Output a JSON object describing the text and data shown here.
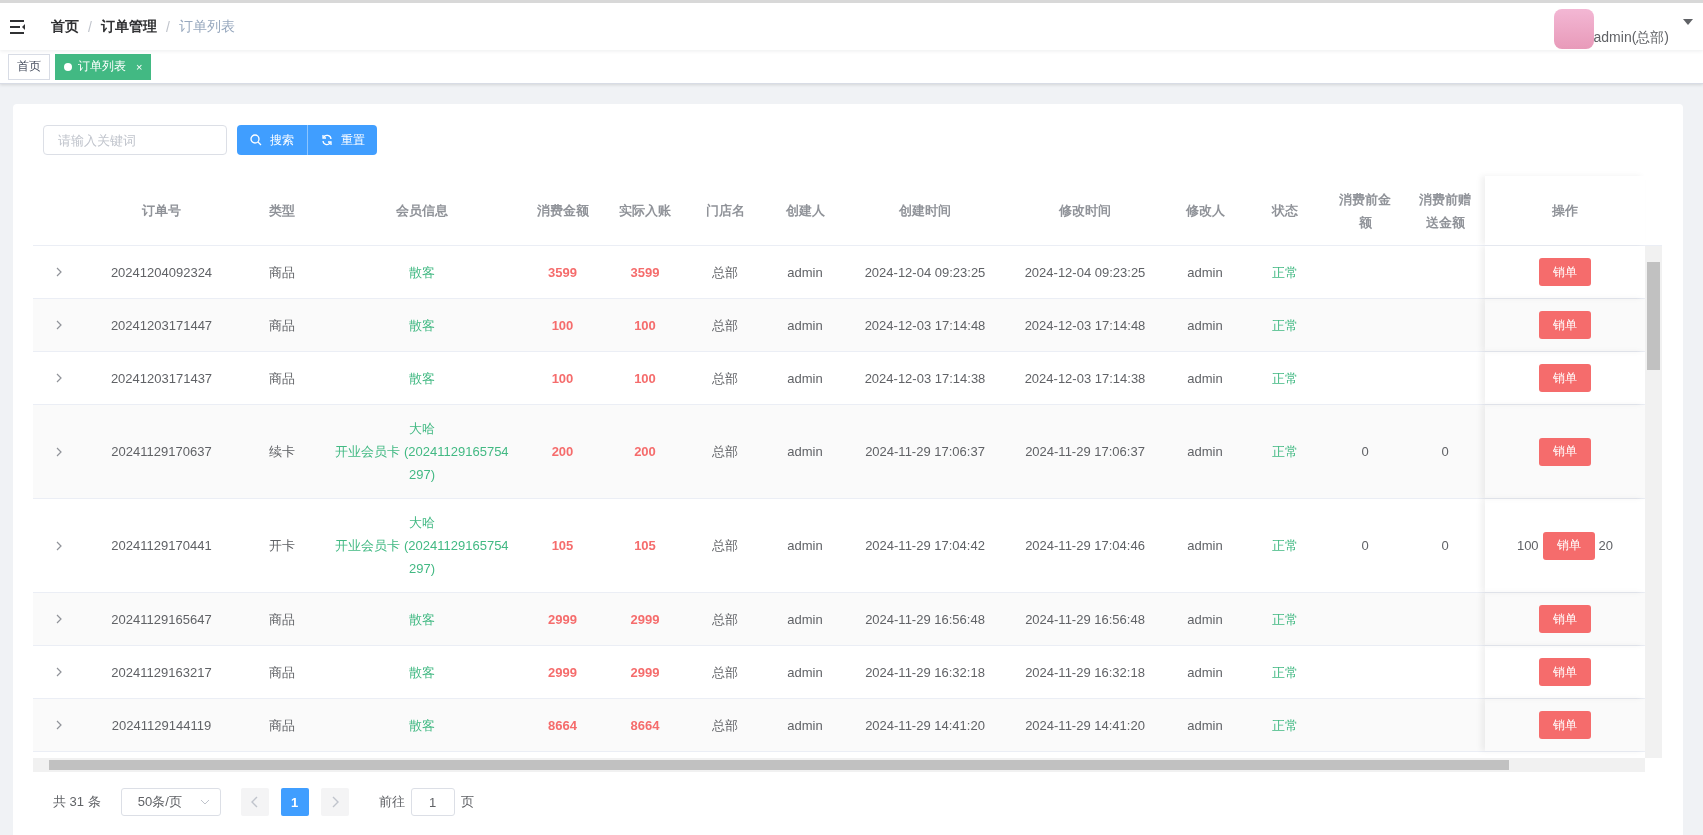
{
  "topbar": {
    "breadcrumb": [
      {
        "label": "首页",
        "current": false
      },
      {
        "label": "订单管理",
        "current": false
      },
      {
        "label": "订单列表",
        "current": true
      }
    ],
    "separator": "/",
    "user": "admin(总部)"
  },
  "tabs": [
    {
      "label": "首页",
      "selected": false
    },
    {
      "label": "订单列表",
      "selected": true,
      "close": "×"
    }
  ],
  "search": {
    "placeholder": "请输入关键词",
    "buttons": [
      {
        "label": "搜索",
        "kind": "search"
      },
      {
        "label": "重置",
        "kind": "reset"
      }
    ]
  },
  "table": {
    "columns": [
      "订单号",
      "类型",
      "会员信息",
      "消费金额",
      "实际入账",
      "门店名",
      "创建人",
      "创建时间",
      "修改时间",
      "修改人",
      "状态",
      "消费前金额",
      "消费前赠送金额",
      "操作"
    ],
    "rows": [
      {
        "order_no": "20241204092324",
        "type": "商品",
        "member": [
          "散客"
        ],
        "amount": "3599",
        "actual": "3599",
        "store": "总部",
        "creator": "admin",
        "created": "2024-12-04 09:23:25",
        "modified": "2024-12-04 09:23:25",
        "modifier": "admin",
        "status": "正常",
        "action": "销单"
      },
      {
        "order_no": "20241203171447",
        "type": "商品",
        "member": [
          "散客"
        ],
        "amount": "100",
        "actual": "100",
        "store": "总部",
        "creator": "admin",
        "created": "2024-12-03 17:14:48",
        "modified": "2024-12-03 17:14:48",
        "modifier": "admin",
        "status": "正常",
        "action": "销单"
      },
      {
        "order_no": "20241203171437",
        "type": "商品",
        "member": [
          "散客"
        ],
        "amount": "100",
        "actual": "100",
        "store": "总部",
        "creator": "admin",
        "created": "2024-12-03 17:14:38",
        "modified": "2024-12-03 17:14:38",
        "modifier": "admin",
        "status": "正常",
        "action": "销单"
      },
      {
        "order_no": "20241129170637",
        "type": "续卡",
        "member": [
          "大哈",
          "开业会员卡 (20241129165754297)"
        ],
        "amount": "200",
        "actual": "200",
        "store": "总部",
        "creator": "admin",
        "created": "2024-11-29 17:06:37",
        "modified": "2024-11-29 17:06:37",
        "modifier": "admin",
        "status": "正常",
        "pre_amount": "0",
        "pre_gift": "0",
        "action": "销单"
      },
      {
        "order_no": "20241129170441",
        "type": "开卡",
        "member": [
          "大哈",
          "开业会员卡 (20241129165754297)"
        ],
        "amount": "105",
        "actual": "105",
        "store": "总部",
        "creator": "admin",
        "created": "2024-11-29 17:04:42",
        "modified": "2024-11-29 17:04:46",
        "modifier": "admin",
        "status": "正常",
        "pre_amount": "0",
        "pre_gift": "0",
        "column_15": "100",
        "column_16": "20",
        "action": "销单"
      },
      {
        "order_no": "20241129165647",
        "type": "商品",
        "member": [
          "散客"
        ],
        "amount": "2999",
        "actual": "2999",
        "store": "总部",
        "creator": "admin",
        "created": "2024-11-29 16:56:48",
        "modified": "2024-11-29 16:56:48",
        "modifier": "admin",
        "status": "正常",
        "action": "销单"
      },
      {
        "order_no": "20241129163217",
        "type": "商品",
        "member": [
          "散客"
        ],
        "amount": "2999",
        "actual": "2999",
        "store": "总部",
        "creator": "admin",
        "created": "2024-11-29 16:32:18",
        "modified": "2024-11-29 16:32:18",
        "modifier": "admin",
        "status": "正常",
        "action": "销单"
      },
      {
        "order_no": "20241129144119",
        "type": "商品",
        "member": [
          "散客"
        ],
        "amount": "8664",
        "actual": "8664",
        "store": "总部",
        "creator": "admin",
        "created": "2024-11-29 14:41:20",
        "modified": "2024-11-29 14:41:20",
        "modifier": "admin",
        "status": "正常",
        "action": "销单"
      }
    ]
  },
  "pagination": {
    "total": "共 31 条",
    "page_size": "50条/页",
    "pages": [
      {
        "label": "1",
        "selected": true
      }
    ],
    "goto_label": "前往",
    "goto_value": "1",
    "goto_suffix": "页"
  }
}
